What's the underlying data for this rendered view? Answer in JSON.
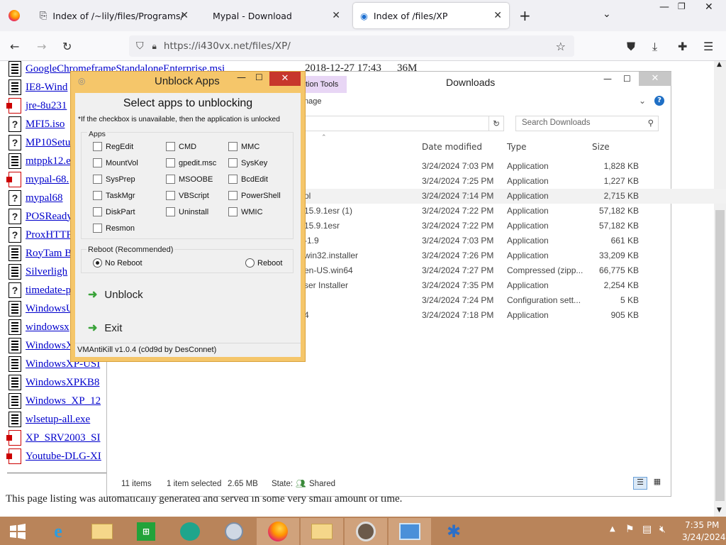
{
  "browser": {
    "tabs": [
      {
        "label": "Index of /~lily/files/Programs/",
        "active": false
      },
      {
        "label": "Mypal - Download",
        "active": false
      },
      {
        "label": "Index of /files/XP",
        "active": true
      }
    ],
    "url": "https://i430vx.net/files/XP/"
  },
  "listing": {
    "top_entry_date": "2018-12-27 17:43",
    "top_entry_size": "36M",
    "entries": [
      {
        "name": "GoogleChromeframeStandaloneEnterprise.msi",
        "icon": "binary"
      },
      {
        "name": "IE8-Wind",
        "icon": "binary"
      },
      {
        "name": "jre-8u231",
        "icon": "exe"
      },
      {
        "name": "MFI5.iso",
        "icon": "unknown"
      },
      {
        "name": "MP10Setu",
        "icon": "unknown"
      },
      {
        "name": "mtppk12.e",
        "icon": "binary"
      },
      {
        "name": "mypal-68.",
        "icon": "exe"
      },
      {
        "name": "mypal68",
        "icon": "unknown"
      },
      {
        "name": "POSReady",
        "icon": "unknown"
      },
      {
        "name": "ProxHTTP",
        "icon": "unknown"
      },
      {
        "name": "RoyTam B",
        "icon": "binary"
      },
      {
        "name": "Silverligh",
        "icon": "binary"
      },
      {
        "name": "timedate-p",
        "icon": "unknown"
      },
      {
        "name": "WindowsU",
        "icon": "binary"
      },
      {
        "name": "windowsx",
        "icon": "binary"
      },
      {
        "name": "WindowsX",
        "icon": "binary"
      },
      {
        "name": "WindowsXP-USI",
        "icon": "binary"
      },
      {
        "name": "WindowsXPKB8",
        "icon": "binary"
      },
      {
        "name": "Windows_XP_12",
        "icon": "binary"
      },
      {
        "name": "wlsetup-all.exe",
        "icon": "binary"
      },
      {
        "name": "XP_SRV2003_SI",
        "icon": "exe"
      },
      {
        "name": "Youtube-DLG-XI",
        "icon": "exe"
      }
    ],
    "footer": "This page listing was automatically generated and served in some very small amount of time."
  },
  "explorer": {
    "title": "Downloads",
    "ribbon_tab": "tion Tools",
    "ribbon_sub": "nage",
    "search_placeholder": "Search Downloads",
    "columns": {
      "date": "Date modified",
      "type": "Type",
      "size": "Size"
    },
    "files": [
      {
        "name": "",
        "date": "3/24/2024 7:03 PM",
        "type": "Application",
        "size": "1,828 KB"
      },
      {
        "name": "",
        "date": "3/24/2024 7:25 PM",
        "type": "Application",
        "size": "1,227 KB"
      },
      {
        "name": "ol",
        "date": "3/24/2024 7:14 PM",
        "type": "Application",
        "size": "2,715 KB",
        "selected": true
      },
      {
        "name": "15.9.1esr (1)",
        "date": "3/24/2024 7:22 PM",
        "type": "Application",
        "size": "57,182 KB"
      },
      {
        "name": "15.9.1esr",
        "date": "3/24/2024 7:22 PM",
        "type": "Application",
        "size": "57,182 KB"
      },
      {
        "name": "-1.9",
        "date": "3/24/2024 7:03 PM",
        "type": "Application",
        "size": "661 KB"
      },
      {
        "name": "win32.installer",
        "date": "3/24/2024 7:26 PM",
        "type": "Application",
        "size": "33,209 KB"
      },
      {
        "name": "en-US.win64",
        "date": "3/24/2024 7:27 PM",
        "type": "Compressed (zipp...",
        "size": "66,775 KB"
      },
      {
        "name": "ser Installer",
        "date": "3/24/2024 7:35 PM",
        "type": "Application",
        "size": "2,254 KB"
      },
      {
        "name": "",
        "date": "3/24/2024 7:24 PM",
        "type": "Configuration sett...",
        "size": "5 KB"
      },
      {
        "name": "4",
        "date": "3/24/2024 7:18 PM",
        "type": "Application",
        "size": "905 KB"
      }
    ],
    "status": {
      "items": "11 items",
      "selected": "1 item selected",
      "size": "2.65 MB",
      "state_label": "State:",
      "state_value": "Shared"
    }
  },
  "dialog": {
    "title": "Unblock Apps",
    "heading": "Select apps to unblocking",
    "note": "*If the checkbox is unavailable, then the application is unlocked",
    "apps_label": "Apps",
    "apps": [
      "RegEdit",
      "CMD",
      "MMC",
      "MountVol",
      "gpedit.msc",
      "SysKey",
      "SysPrep",
      "MSOOBE",
      "BcdEdit",
      "TaskMgr",
      "VBScript",
      "PowerShell",
      "DiskPart",
      "Uninstall",
      "WMIC",
      "Resmon"
    ],
    "reboot_label": "Reboot (Recommended)",
    "no_reboot": "No Reboot",
    "reboot": "Reboot",
    "unblock": "Unblock",
    "exit": "Exit",
    "footer": "VMAntiKill v1.0.4 (c0d9d by DesConnet)"
  },
  "taskbar": {
    "time": "7:35 PM",
    "date": "3/24/2024"
  },
  "colors": {
    "dialog_border": "#f5c66a",
    "taskbar": "#b9845a",
    "link": "#0000cc",
    "ribbon_tab": "#e8d6f5"
  }
}
